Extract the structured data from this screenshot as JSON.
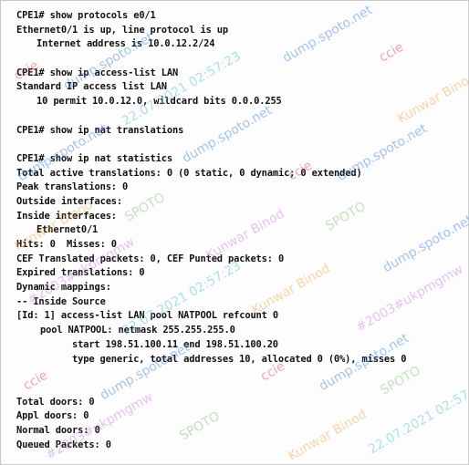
{
  "terminal": {
    "lines": [
      {
        "text": "CPE1# show protocols e0/1",
        "indent": 0
      },
      {
        "text": "Ethernet0/1 is up, line protocol is up",
        "indent": 0
      },
      {
        "text": "Internet address is 10.0.12.2/24",
        "indent": 1
      },
      {
        "text": "",
        "indent": 0
      },
      {
        "text": "CPE1# show ip access-list LAN",
        "indent": 0
      },
      {
        "text": "Standard IP access list LAN",
        "indent": 0
      },
      {
        "text": "10 permit 10.0.12.0, wildcard bits 0.0.0.255",
        "indent": 1
      },
      {
        "text": "",
        "indent": 0
      },
      {
        "text": "CPE1# show ip nat translations",
        "indent": 0
      },
      {
        "text": "",
        "indent": 0
      },
      {
        "text": "CPE1# show ip nat statistics",
        "indent": 0
      },
      {
        "text": "Total active translations: 0 (0 static, 0 dynamic; 0 extended)",
        "indent": 0
      },
      {
        "text": "Peak translations: 0",
        "indent": 0
      },
      {
        "text": "Outside interfaces:",
        "indent": 0
      },
      {
        "text": "Inside interfaces:",
        "indent": 0
      },
      {
        "text": "Ethernet0/1",
        "indent": 1
      },
      {
        "text": "Hits: 0  Misses: 0",
        "indent": 0
      },
      {
        "text": "CEF Translated packets: 0, CEF Punted packets: 0",
        "indent": 0
      },
      {
        "text": "Expired translations: 0",
        "indent": 0
      },
      {
        "text": "Dynamic mappings:",
        "indent": 0
      },
      {
        "text": "-- Inside Source",
        "indent": 0
      },
      {
        "text": "[Id: 1] access-list LAN pool NATPOOL refcount 0",
        "indent": 0
      },
      {
        "text": "pool NATPOOL: netmask 255.255.255.0",
        "indent": 3
      },
      {
        "text": "start 198.51.100.11 end 198.51.100.20",
        "indent": 4
      },
      {
        "text": "type generic, total addresses 10, allocated 0 (0%), misses 0",
        "indent": 4
      },
      {
        "text": "",
        "indent": 0
      },
      {
        "text": "",
        "indent": 0
      },
      {
        "text": "Total doors: 0",
        "indent": 0
      },
      {
        "text": "Appl doors: 0",
        "indent": 0
      },
      {
        "text": "Normal doors: 0",
        "indent": 0
      },
      {
        "text": "Queued Packets: 0",
        "indent": 0
      }
    ]
  },
  "watermark": {
    "texts": [
      "ccie",
      "dump.spoto.net",
      "SPOTO",
      "Kunwar Binod",
      "#2003#ukpmgmw",
      "22.07.2021 02:57:23"
    ],
    "colors": [
      "#e8343c",
      "#2f7de1",
      "#7cc36a",
      "#f2a23a",
      "#c77ad8",
      "#46bfc8"
    ]
  }
}
